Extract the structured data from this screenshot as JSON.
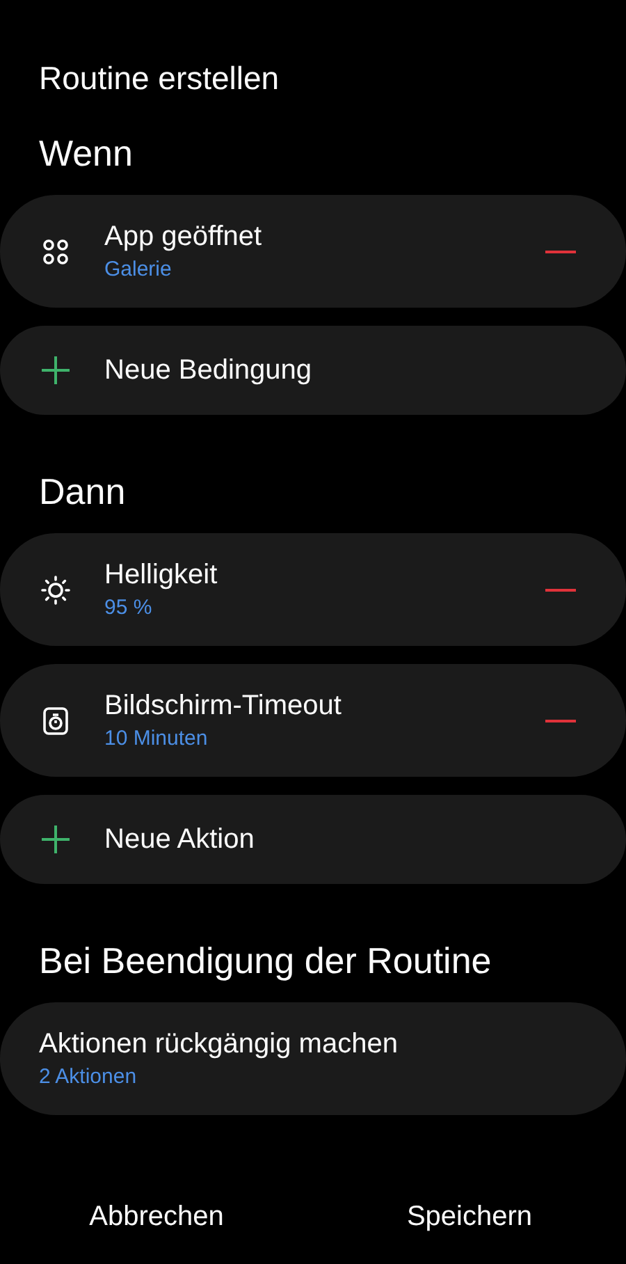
{
  "title": "Routine erstellen",
  "sections": [
    {
      "heading": "Wenn",
      "items": [
        {
          "kind": "app",
          "title": "App geöffnet",
          "value": "Galerie",
          "removable": true
        },
        {
          "kind": "add",
          "label": "Neue Bedingung"
        }
      ]
    },
    {
      "heading": "Dann",
      "items": [
        {
          "kind": "brightness",
          "title": "Helligkeit",
          "value": "95 %",
          "removable": true
        },
        {
          "kind": "timeout",
          "title": "Bildschirm-Timeout",
          "value": "10 Minuten",
          "removable": true
        },
        {
          "kind": "add",
          "label": "Neue Aktion"
        }
      ]
    },
    {
      "heading": "Bei Beendigung der Routine",
      "items": [
        {
          "kind": "undo",
          "title": "Aktionen rückgängig machen",
          "value": "2 Aktionen",
          "removable": false
        }
      ]
    }
  ],
  "buttons": [
    "Abbrechen",
    "Speichern"
  ]
}
